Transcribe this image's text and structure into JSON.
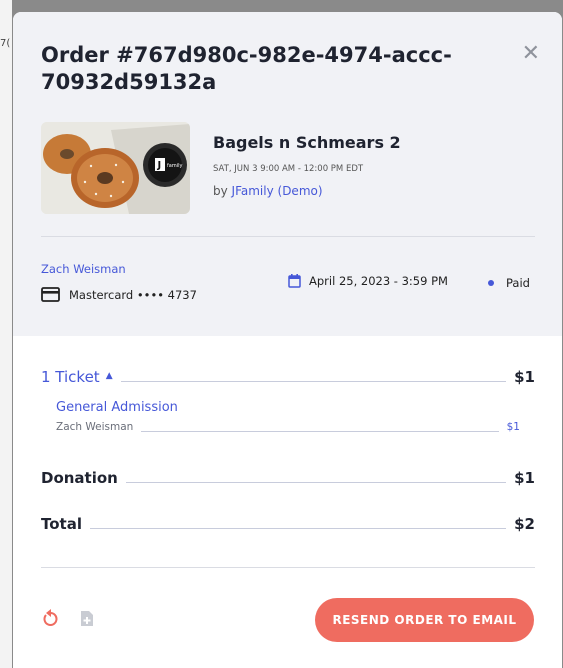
{
  "background": {
    "fragment": "7("
  },
  "order": {
    "title": "Order #767d980c-982e-4974-accc-70932d59132a",
    "close_icon": "close-icon"
  },
  "event": {
    "name": "Bagels n Schmears 2",
    "date": "SAT, JUN 3 9:00 AM - 12:00 PM EDT",
    "by_prefix": "by",
    "organizer": "JFamily (Demo)",
    "image_badge": "J",
    "image_badge_text": "family"
  },
  "buyer": {
    "name": "Zach Weisman",
    "card": "Mastercard •••• 4737",
    "card_icon": "credit-card-icon"
  },
  "purchase": {
    "date": "April 25, 2023 - 3:59 PM",
    "date_icon": "calendar-icon",
    "status": "Paid"
  },
  "line_items": {
    "tickets_label": "1 Ticket",
    "tickets_amount": "$1",
    "ticket_type": "General Admission",
    "ticket_holder": "Zach Weisman",
    "ticket_holder_amount": "$1",
    "donation_label": "Donation",
    "donation_amount": "$1",
    "total_label": "Total",
    "total_amount": "$2"
  },
  "footer": {
    "refund_icon": "refund-icon",
    "document_icon": "add-document-icon",
    "resend_label": "RESEND ORDER TO EMAIL"
  },
  "colors": {
    "accent": "#4658d8",
    "button": "#ef6c60",
    "header_bg": "#f1f2f6",
    "title": "#1f2330"
  }
}
